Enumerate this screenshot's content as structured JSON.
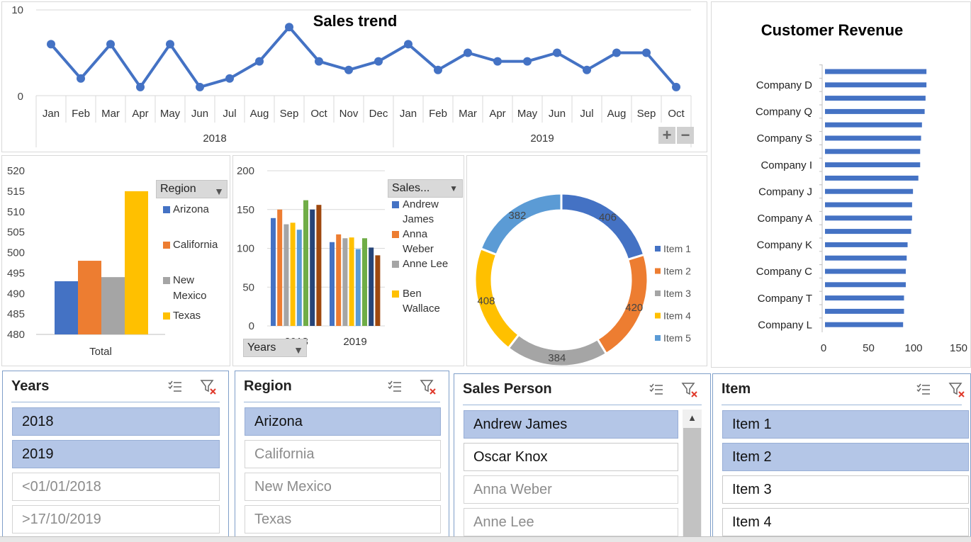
{
  "sales_trend": {
    "title": "Sales trend",
    "y_ticks": [
      "10",
      "0"
    ],
    "plus_label": "+",
    "minus_label": "−",
    "chart_data": {
      "type": "line",
      "title": "Sales trend",
      "ylim": [
        0,
        10
      ],
      "x_groups": [
        {
          "label": "2018",
          "months": [
            "Jan",
            "Feb",
            "Mar",
            "Apr",
            "May",
            "Jun",
            "Jul",
            "Aug",
            "Sep",
            "Oct",
            "Nov",
            "Dec"
          ]
        },
        {
          "label": "2019",
          "months": [
            "Jan",
            "Feb",
            "Mar",
            "Apr",
            "May",
            "Jun",
            "Jul",
            "Aug",
            "Sep",
            "Oct"
          ]
        }
      ],
      "values": [
        6,
        2,
        6,
        1,
        6,
        1,
        2,
        4,
        8,
        4,
        3,
        4,
        6,
        3,
        5,
        4,
        4,
        5,
        3,
        5,
        5,
        1
      ],
      "color": "#4472c4"
    }
  },
  "customer_revenue": {
    "title": "Customer Revenue",
    "x_ticks": [
      "0",
      "50",
      "100",
      "150"
    ],
    "chart_data": {
      "type": "bar",
      "orientation": "horizontal",
      "title": "Customer Revenue",
      "xlim": [
        0,
        150
      ],
      "category_labels": [
        "Company D",
        "Company Q",
        "Company S",
        "Company I",
        "Company J",
        "Company A",
        "Company K",
        "Company C",
        "Company T",
        "Company L"
      ],
      "values": [
        113,
        113,
        112,
        111,
        108,
        107,
        106,
        106,
        104,
        98,
        97,
        97,
        96,
        92,
        91,
        90,
        90,
        88,
        88,
        87
      ],
      "color": "#4472c4"
    }
  },
  "region_chart": {
    "field_button": "Region",
    "x_label": "Total",
    "y_ticks": [
      "520",
      "515",
      "510",
      "505",
      "500",
      "495",
      "490",
      "485",
      "480"
    ],
    "legend": [
      {
        "label": "Arizona",
        "color": "#4472c4"
      },
      {
        "label": "California",
        "color": "#ed7d31"
      },
      {
        "label": "New Mexico",
        "color": "#a5a5a5"
      },
      {
        "label": "Texas",
        "color": "#ffc000"
      }
    ],
    "chart_data": {
      "type": "bar",
      "categories": [
        "Total"
      ],
      "ylim": [
        480,
        520
      ],
      "series": [
        {
          "name": "Arizona",
          "values": [
            493
          ]
        },
        {
          "name": "California",
          "values": [
            498
          ]
        },
        {
          "name": "New Mexico",
          "values": [
            494
          ]
        },
        {
          "name": "Texas",
          "values": [
            515
          ]
        }
      ]
    }
  },
  "sales_person_chart": {
    "field_button": "Sales...",
    "years_button": "Years",
    "x_labels": [
      "2018",
      "2019"
    ],
    "y_ticks": [
      "200",
      "150",
      "100",
      "50",
      "0"
    ],
    "legend": [
      {
        "label": "Andrew James",
        "color": "#4472c4"
      },
      {
        "label": "Anna Weber",
        "color": "#ed7d31"
      },
      {
        "label": "Anne Lee",
        "color": "#a5a5a5"
      },
      {
        "label": "Ben Wallace",
        "color": "#ffc000"
      }
    ],
    "chart_data": {
      "type": "bar",
      "categories": [
        "2018",
        "2019"
      ],
      "ylim": [
        0,
        200
      ],
      "series_values": [
        [
          139,
          108
        ],
        [
          150,
          118
        ],
        [
          131,
          113
        ],
        [
          133,
          114
        ],
        [
          124,
          99
        ],
        [
          162,
          113
        ],
        [
          150,
          101
        ],
        [
          156,
          91
        ]
      ],
      "series_colors": [
        "#4472c4",
        "#ed7d31",
        "#a5a5a5",
        "#ffc000",
        "#5b9bd5",
        "#70ad47",
        "#264478",
        "#9e480e"
      ]
    }
  },
  "items_chart": {
    "legend": [
      {
        "label": "Item 1",
        "color": "#4472c4"
      },
      {
        "label": "Item 2",
        "color": "#ed7d31"
      },
      {
        "label": "Item 3",
        "color": "#a5a5a5"
      },
      {
        "label": "Item 4",
        "color": "#ffc000"
      },
      {
        "label": "Item 5",
        "color": "#5b9bd5"
      }
    ],
    "chart_data": {
      "type": "pie",
      "variant": "doughnut",
      "labels": [
        "Item 1",
        "Item 2",
        "Item 3",
        "Item 4",
        "Item 5"
      ],
      "values": [
        406,
        420,
        384,
        408,
        382
      ],
      "colors": [
        "#4472c4",
        "#ed7d31",
        "#a5a5a5",
        "#ffc000",
        "#5b9bd5"
      ]
    }
  },
  "slicers": {
    "years": {
      "title": "Years",
      "items": [
        {
          "label": "2018",
          "state": "sel"
        },
        {
          "label": "2019",
          "state": "sel"
        },
        {
          "label": "<01/01/2018",
          "state": "unavail"
        },
        {
          "label": ">17/10/2019",
          "state": "unavail"
        }
      ]
    },
    "region": {
      "title": "Region",
      "items": [
        {
          "label": "Arizona",
          "state": "sel"
        },
        {
          "label": "California",
          "state": "unavail"
        },
        {
          "label": "New Mexico",
          "state": "unavail"
        },
        {
          "label": "Texas",
          "state": "unavail"
        }
      ]
    },
    "sales_person": {
      "title": "Sales Person",
      "items": [
        {
          "label": "Andrew James",
          "state": "sel"
        },
        {
          "label": "Oscar Knox",
          "state": "avail"
        },
        {
          "label": "Anna Weber",
          "state": "unavail"
        },
        {
          "label": "Anne Lee",
          "state": "unavail"
        }
      ]
    },
    "item": {
      "title": "Item",
      "items": [
        {
          "label": "Item 1",
          "state": "sel"
        },
        {
          "label": "Item 2",
          "state": "sel"
        },
        {
          "label": "Item 3",
          "state": "avail"
        },
        {
          "label": "Item 4",
          "state": "avail"
        }
      ]
    }
  }
}
